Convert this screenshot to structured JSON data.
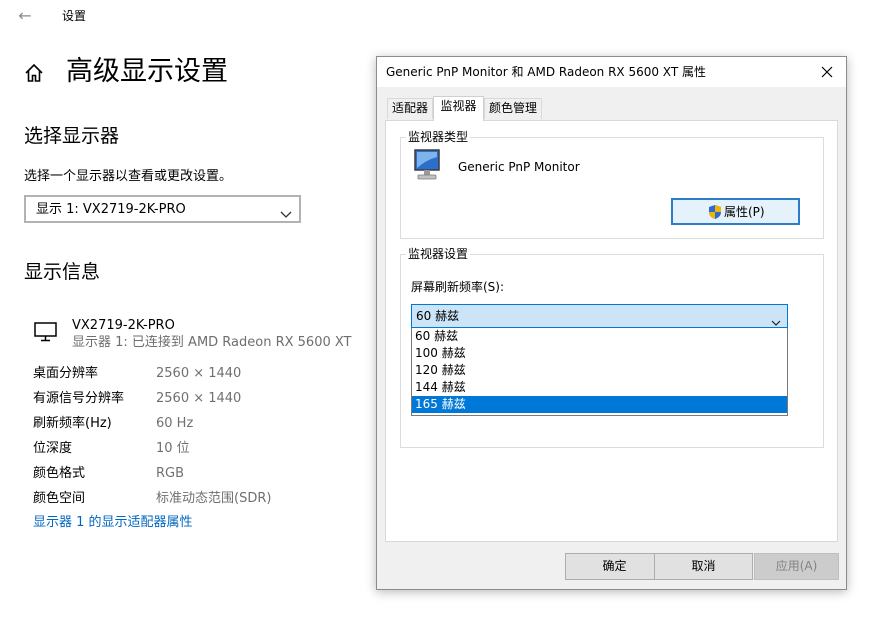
{
  "window": {
    "app_title": "设置",
    "page_title": "高级显示设置"
  },
  "select_display": {
    "heading": "选择显示器",
    "description": "选择一个显示器以查看或更改设置。",
    "selected": "显示 1: VX2719-2K-PRO"
  },
  "display_info": {
    "heading": "显示信息",
    "monitor_name": "VX2719-2K-PRO",
    "monitor_subtitle": "显示器 1: 已连接到 AMD Radeon RX 5600 XT",
    "rows": [
      {
        "label": "桌面分辨率",
        "value": "2560 × 1440"
      },
      {
        "label": "有源信号分辨率",
        "value": "2560 × 1440"
      },
      {
        "label": "刷新频率(Hz)",
        "value": "60 Hz"
      },
      {
        "label": "位深度",
        "value": "10 位"
      },
      {
        "label": "颜色格式",
        "value": "RGB"
      },
      {
        "label": "颜色空间",
        "value": "标准动态范围(SDR)"
      }
    ],
    "adapter_link": "显示器 1 的显示适配器属性"
  },
  "dialog": {
    "title": "Generic PnP Monitor 和 AMD Radeon RX 5600 XT 属性",
    "tabs": [
      {
        "label": "适配器",
        "active": false
      },
      {
        "label": "监视器",
        "active": true
      },
      {
        "label": "颜色管理",
        "active": false
      }
    ],
    "monitor_type": {
      "legend": "监视器类型",
      "name": "Generic PnP Monitor",
      "properties_button": "属性(P)"
    },
    "monitor_settings": {
      "legend": "监视器设置",
      "refresh_label": "屏幕刷新频率(S):",
      "refresh_selected": "60 赫兹",
      "refresh_options": [
        "60 赫兹",
        "100 赫兹",
        "120 赫兹",
        "144 赫兹",
        "165 赫兹"
      ],
      "highlighted_option": "165 赫兹"
    },
    "buttons": {
      "ok": "确定",
      "cancel": "取消",
      "apply": "应用(A)"
    }
  },
  "colors": {
    "link": "#0067c0",
    "accent": "#0078d7",
    "combo_highlight": "#cce4f7",
    "shield_blue": "#2b6cd4",
    "shield_gold": "#f2b400"
  }
}
